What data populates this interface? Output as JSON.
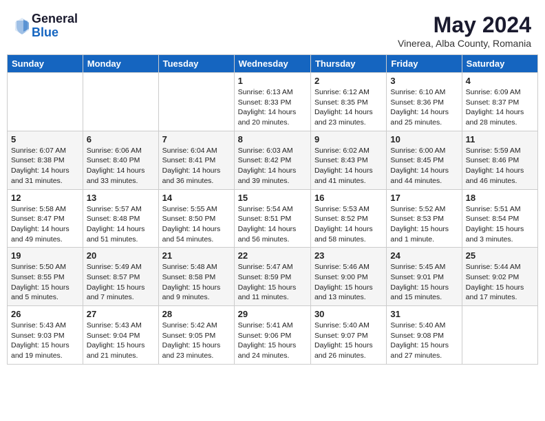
{
  "header": {
    "logo_general": "General",
    "logo_blue": "Blue",
    "month": "May 2024",
    "location": "Vinerea, Alba County, Romania"
  },
  "weekdays": [
    "Sunday",
    "Monday",
    "Tuesday",
    "Wednesday",
    "Thursday",
    "Friday",
    "Saturday"
  ],
  "weeks": [
    [
      {
        "day": "",
        "info": ""
      },
      {
        "day": "",
        "info": ""
      },
      {
        "day": "",
        "info": ""
      },
      {
        "day": "1",
        "info": "Sunrise: 6:13 AM\nSunset: 8:33 PM\nDaylight: 14 hours\nand 20 minutes."
      },
      {
        "day": "2",
        "info": "Sunrise: 6:12 AM\nSunset: 8:35 PM\nDaylight: 14 hours\nand 23 minutes."
      },
      {
        "day": "3",
        "info": "Sunrise: 6:10 AM\nSunset: 8:36 PM\nDaylight: 14 hours\nand 25 minutes."
      },
      {
        "day": "4",
        "info": "Sunrise: 6:09 AM\nSunset: 8:37 PM\nDaylight: 14 hours\nand 28 minutes."
      }
    ],
    [
      {
        "day": "5",
        "info": "Sunrise: 6:07 AM\nSunset: 8:38 PM\nDaylight: 14 hours\nand 31 minutes."
      },
      {
        "day": "6",
        "info": "Sunrise: 6:06 AM\nSunset: 8:40 PM\nDaylight: 14 hours\nand 33 minutes."
      },
      {
        "day": "7",
        "info": "Sunrise: 6:04 AM\nSunset: 8:41 PM\nDaylight: 14 hours\nand 36 minutes."
      },
      {
        "day": "8",
        "info": "Sunrise: 6:03 AM\nSunset: 8:42 PM\nDaylight: 14 hours\nand 39 minutes."
      },
      {
        "day": "9",
        "info": "Sunrise: 6:02 AM\nSunset: 8:43 PM\nDaylight: 14 hours\nand 41 minutes."
      },
      {
        "day": "10",
        "info": "Sunrise: 6:00 AM\nSunset: 8:45 PM\nDaylight: 14 hours\nand 44 minutes."
      },
      {
        "day": "11",
        "info": "Sunrise: 5:59 AM\nSunset: 8:46 PM\nDaylight: 14 hours\nand 46 minutes."
      }
    ],
    [
      {
        "day": "12",
        "info": "Sunrise: 5:58 AM\nSunset: 8:47 PM\nDaylight: 14 hours\nand 49 minutes."
      },
      {
        "day": "13",
        "info": "Sunrise: 5:57 AM\nSunset: 8:48 PM\nDaylight: 14 hours\nand 51 minutes."
      },
      {
        "day": "14",
        "info": "Sunrise: 5:55 AM\nSunset: 8:50 PM\nDaylight: 14 hours\nand 54 minutes."
      },
      {
        "day": "15",
        "info": "Sunrise: 5:54 AM\nSunset: 8:51 PM\nDaylight: 14 hours\nand 56 minutes."
      },
      {
        "day": "16",
        "info": "Sunrise: 5:53 AM\nSunset: 8:52 PM\nDaylight: 14 hours\nand 58 minutes."
      },
      {
        "day": "17",
        "info": "Sunrise: 5:52 AM\nSunset: 8:53 PM\nDaylight: 15 hours\nand 1 minute."
      },
      {
        "day": "18",
        "info": "Sunrise: 5:51 AM\nSunset: 8:54 PM\nDaylight: 15 hours\nand 3 minutes."
      }
    ],
    [
      {
        "day": "19",
        "info": "Sunrise: 5:50 AM\nSunset: 8:55 PM\nDaylight: 15 hours\nand 5 minutes."
      },
      {
        "day": "20",
        "info": "Sunrise: 5:49 AM\nSunset: 8:57 PM\nDaylight: 15 hours\nand 7 minutes."
      },
      {
        "day": "21",
        "info": "Sunrise: 5:48 AM\nSunset: 8:58 PM\nDaylight: 15 hours\nand 9 minutes."
      },
      {
        "day": "22",
        "info": "Sunrise: 5:47 AM\nSunset: 8:59 PM\nDaylight: 15 hours\nand 11 minutes."
      },
      {
        "day": "23",
        "info": "Sunrise: 5:46 AM\nSunset: 9:00 PM\nDaylight: 15 hours\nand 13 minutes."
      },
      {
        "day": "24",
        "info": "Sunrise: 5:45 AM\nSunset: 9:01 PM\nDaylight: 15 hours\nand 15 minutes."
      },
      {
        "day": "25",
        "info": "Sunrise: 5:44 AM\nSunset: 9:02 PM\nDaylight: 15 hours\nand 17 minutes."
      }
    ],
    [
      {
        "day": "26",
        "info": "Sunrise: 5:43 AM\nSunset: 9:03 PM\nDaylight: 15 hours\nand 19 minutes."
      },
      {
        "day": "27",
        "info": "Sunrise: 5:43 AM\nSunset: 9:04 PM\nDaylight: 15 hours\nand 21 minutes."
      },
      {
        "day": "28",
        "info": "Sunrise: 5:42 AM\nSunset: 9:05 PM\nDaylight: 15 hours\nand 23 minutes."
      },
      {
        "day": "29",
        "info": "Sunrise: 5:41 AM\nSunset: 9:06 PM\nDaylight: 15 hours\nand 24 minutes."
      },
      {
        "day": "30",
        "info": "Sunrise: 5:40 AM\nSunset: 9:07 PM\nDaylight: 15 hours\nand 26 minutes."
      },
      {
        "day": "31",
        "info": "Sunrise: 5:40 AM\nSunset: 9:08 PM\nDaylight: 15 hours\nand 27 minutes."
      },
      {
        "day": "",
        "info": ""
      }
    ]
  ]
}
